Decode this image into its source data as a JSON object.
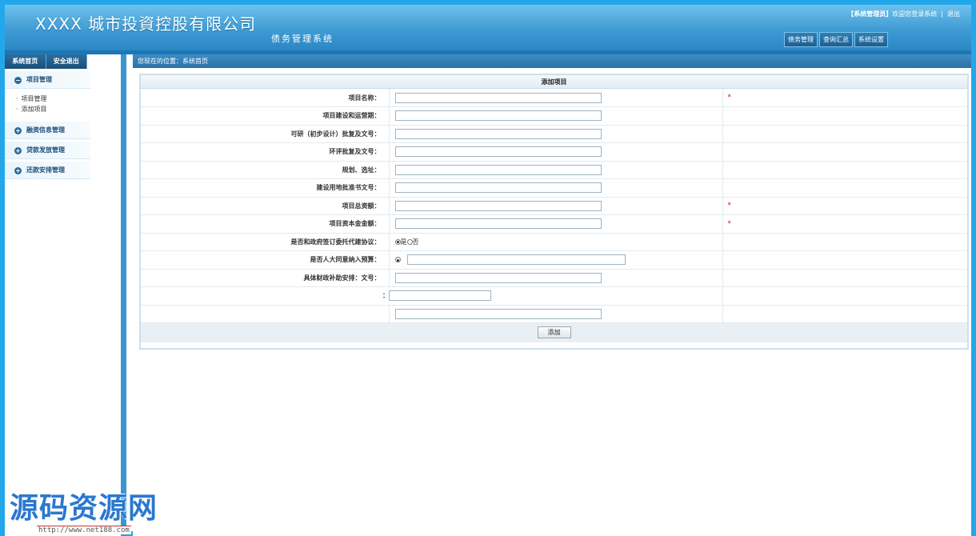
{
  "header": {
    "title": "XXXX 城市投資控股有限公司",
    "subtitle": "债务管理系统",
    "user_role": "【系统管理员】",
    "welcome": "欢迎您登录系统",
    "logout": "退出",
    "nav": [
      "债务管理",
      "查询汇总",
      "系统设置"
    ]
  },
  "sidebar": {
    "top_buttons": [
      "系统首页",
      "安全退出"
    ],
    "groups": [
      {
        "label": "项目管理",
        "icon": "minus-circle-icon",
        "items": [
          "项目管理",
          "添加项目"
        ]
      },
      {
        "label": "融资信息管理",
        "icon": "plus-circle-icon"
      },
      {
        "label": "贷款发放管理",
        "icon": "plus-circle-icon"
      },
      {
        "label": "还款安排管理",
        "icon": "plus-circle-icon"
      }
    ]
  },
  "breadcrumb": {
    "prefix": "您现在的位置：",
    "current": "系统首页"
  },
  "form": {
    "title": "添加项目",
    "rows": [
      {
        "label": "项目名称：",
        "required": "*"
      },
      {
        "label": "项目建设和运营期：",
        "required": ""
      },
      {
        "label": "可研（初步设计）批复及文号：",
        "required": ""
      },
      {
        "label": "环评批复及文号：",
        "required": ""
      },
      {
        "label": "规划、选址：",
        "required": ""
      },
      {
        "label": "建设用地批准书文号：",
        "required": ""
      },
      {
        "label": "项目总资额：",
        "required": "*"
      },
      {
        "label": "项目资本金金额：",
        "required": "*"
      }
    ],
    "radio_label": "是否和政府签订委托代建协议：",
    "radio_yes": "是",
    "radio_no": "否",
    "budget_label": "是否人大同意纳入预算：",
    "subsidy_label": "具体财政补助安排：文号：",
    "extra_label": "：",
    "submit": "添加"
  },
  "watermark": {
    "text": "源码资源网",
    "url": "http://www.net188.com"
  }
}
